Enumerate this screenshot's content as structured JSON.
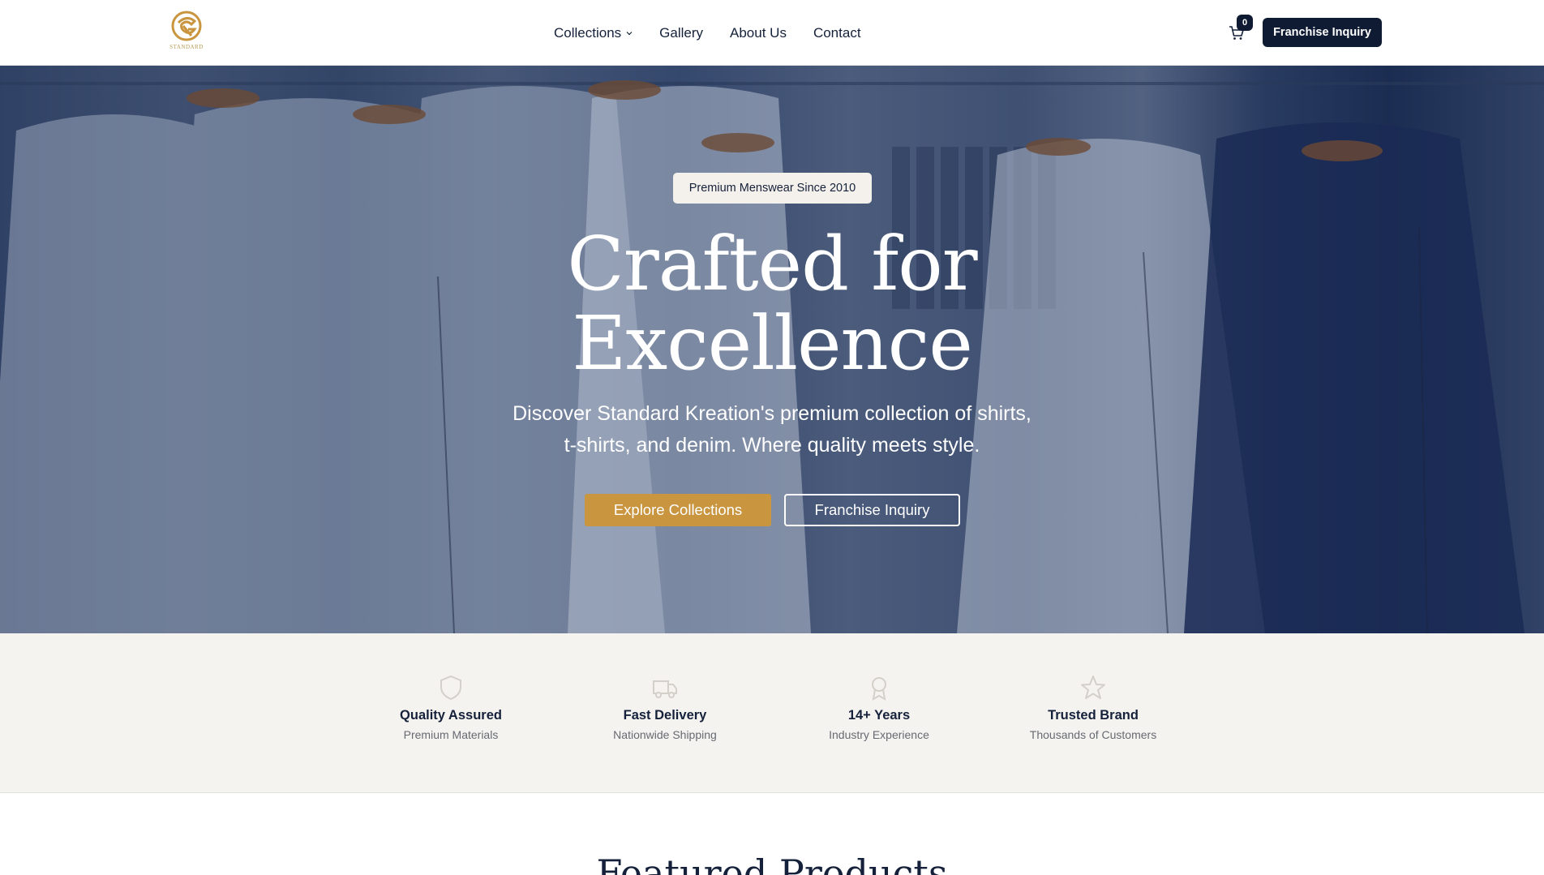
{
  "header": {
    "logo_text": "STANDARD",
    "nav": [
      {
        "label": "Collections",
        "has_dropdown": true
      },
      {
        "label": "Gallery"
      },
      {
        "label": "About Us"
      },
      {
        "label": "Contact"
      }
    ],
    "cart_icon": "shopping-cart-icon",
    "cart_count": "0",
    "cta_label": "Franchise Inquiry"
  },
  "hero": {
    "badge": "Premium Menswear Since 2010",
    "title_line1": "Crafted for",
    "title_line2": "Excellence",
    "subtitle_line1": "Discover Standard Kreation's premium collection of shirts,",
    "subtitle_line2": "t-shirts, and denim. Where quality meets style.",
    "primary_button": "Explore Collections",
    "secondary_button": "Franchise Inquiry"
  },
  "features": [
    {
      "icon": "shield-icon",
      "title": "Quality Assured",
      "subtitle": "Premium Materials"
    },
    {
      "icon": "truck-icon",
      "title": "Fast Delivery",
      "subtitle": "Nationwide Shipping"
    },
    {
      "icon": "award-icon",
      "title": "14+ Years",
      "subtitle": "Industry Experience"
    },
    {
      "icon": "star-icon",
      "title": "Trusted Brand",
      "subtitle": "Thousands of Customers"
    }
  ],
  "featured": {
    "title": "Featured Products"
  },
  "colors": {
    "navy": "#0f1b33",
    "gold": "#c9953f",
    "strip_bg": "#f5f3f0"
  }
}
